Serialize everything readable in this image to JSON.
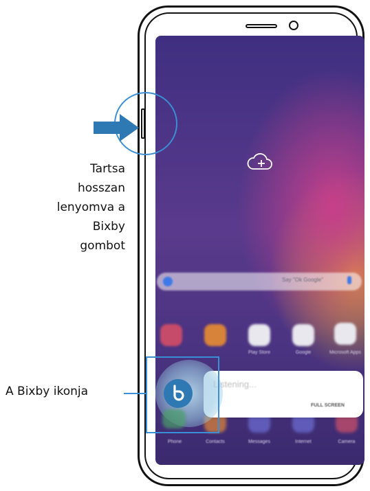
{
  "annotations": {
    "instruction_lines": [
      "Tartsa",
      "hosszan",
      "lenyomva a",
      "Bixby",
      "gombot"
    ],
    "bixby_icon_label": "A Bixby ikonja"
  },
  "screen": {
    "search_hint": "Say \"Ok Google\"",
    "apps": [
      "",
      "",
      "Play Store",
      "Google",
      "Microsoft Apps"
    ],
    "dock": [
      "Phone",
      "Contacts",
      "Messages",
      "Internet",
      "Camera"
    ],
    "listening_text": "Listening...",
    "full_screen_button": "FULL SCREEN"
  },
  "colors": {
    "accent": "#3b8fd6",
    "bixby": "#2e78b3",
    "wallpaper": "#4c3482"
  },
  "icons": {
    "callout_arrow": "arrow-right-icon",
    "cloud": "cloud-plus-icon",
    "bixby": "bixby-icon"
  }
}
